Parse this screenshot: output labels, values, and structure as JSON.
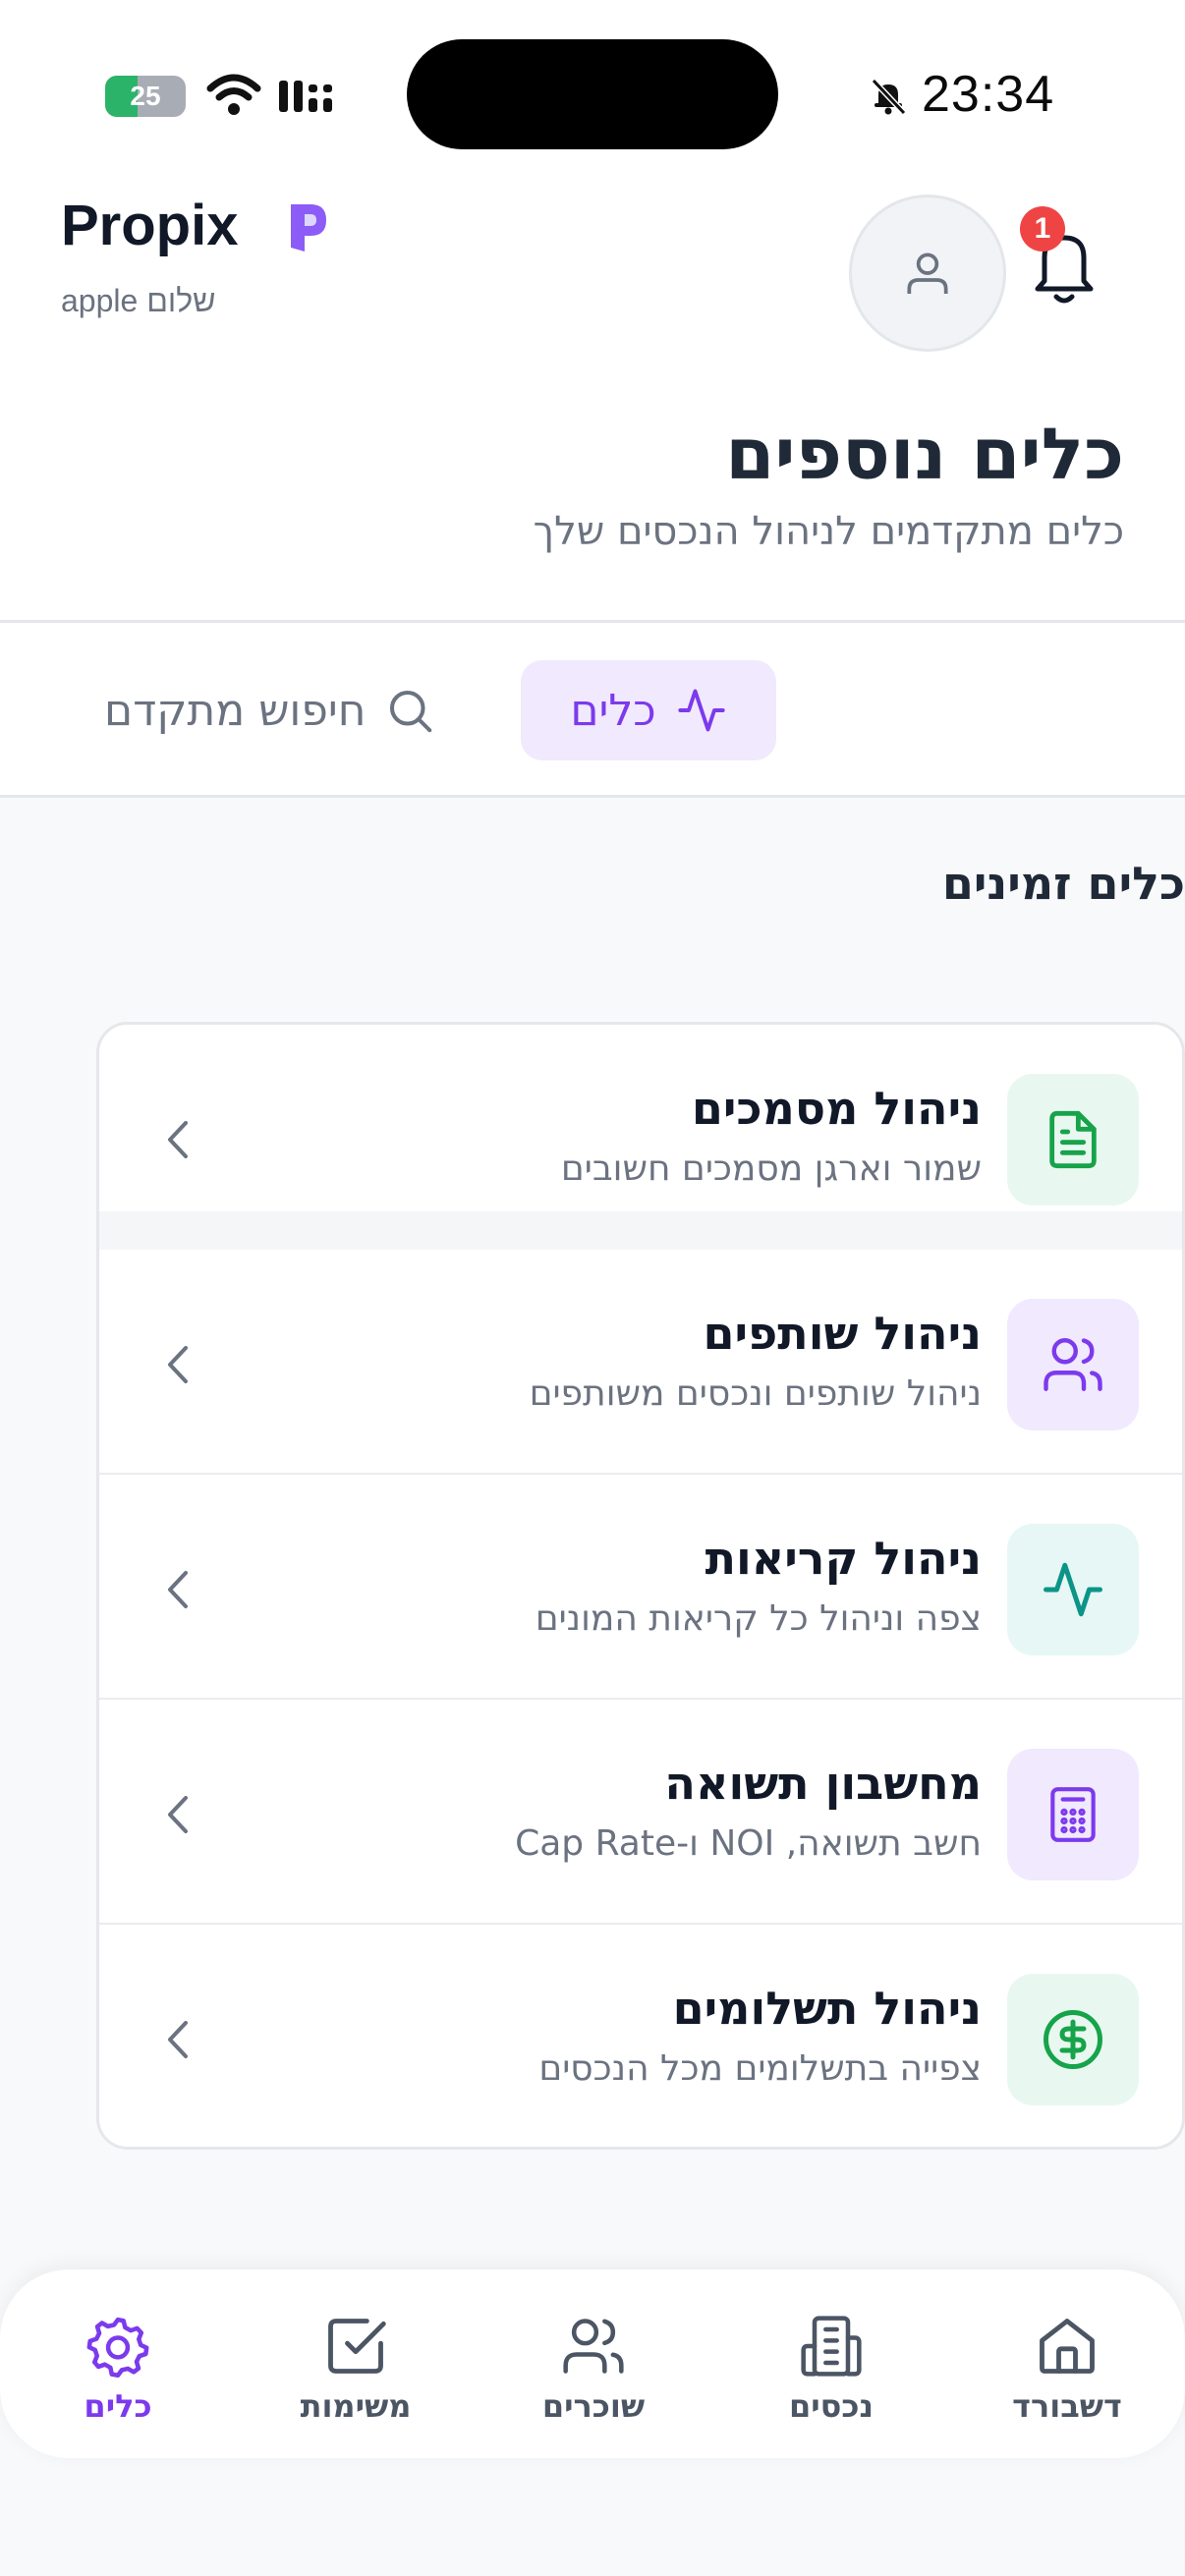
{
  "status_bar": {
    "time": "23:34",
    "battery": "25"
  },
  "header": {
    "brand": "Propix",
    "greeting": "apple שלום",
    "notification_count": "1"
  },
  "page": {
    "title": "כלים נוספים",
    "subtitle": "כלים מתקדמים לניהול הנכסים שלך"
  },
  "tabs": {
    "active_label": "כלים",
    "search_label": "חיפוש מתקדם"
  },
  "section_title": "כלים זמינים",
  "tools": [
    {
      "title": "ניהול מסמכים",
      "description": "שמור וארגן מסמכים חשובים",
      "icon": "document-icon"
    },
    {
      "title": "ניהול שותפים",
      "description": "ניהול שותפים ונכסים משותפים",
      "icon": "users-icon"
    },
    {
      "title": "ניהול קריאות",
      "description": "צפה וניהול כל קריאות המונים",
      "icon": "activity-icon"
    },
    {
      "title": "מחשבון תשואה",
      "description": "חשב תשואה, NOI ו-Cap Rate",
      "icon": "calculator-icon"
    },
    {
      "title": "ניהול תשלומים",
      "description": "צפייה בתשלומים מכל הנכסים",
      "icon": "dollar-icon"
    }
  ],
  "nav": [
    {
      "label": "כלים",
      "icon": "gear-icon",
      "active": true
    },
    {
      "label": "משימות",
      "icon": "checkbox-icon",
      "active": false
    },
    {
      "label": "שוכרים",
      "icon": "users-icon",
      "active": false
    },
    {
      "label": "נכסים",
      "icon": "building-icon",
      "active": false
    },
    {
      "label": "דשבורד",
      "icon": "home-icon",
      "active": false
    }
  ],
  "colors": {
    "accent": "#7c3aed",
    "accent_bg": "#f1e9fd",
    "green": "#16a34a",
    "teal": "#0d9488",
    "badge": "#ef4444"
  }
}
